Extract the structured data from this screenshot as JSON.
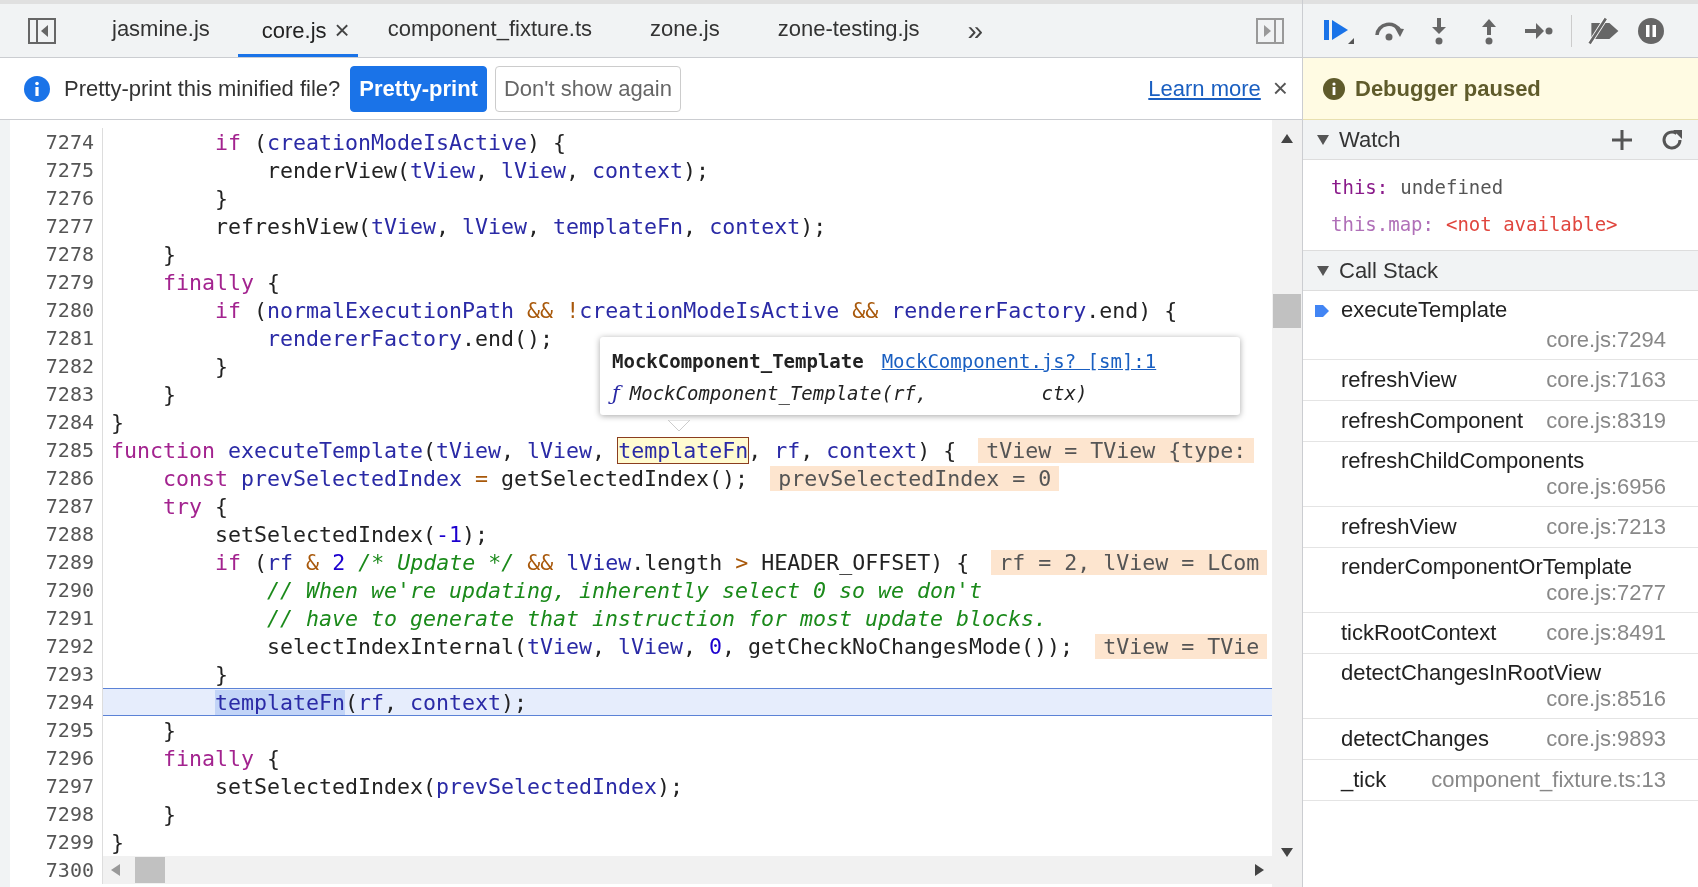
{
  "tabs": [
    {
      "label": "jasmine.js",
      "selected": false
    },
    {
      "label": "core.js",
      "selected": true,
      "close": "×"
    },
    {
      "label": "component_fixture.ts",
      "selected": false
    },
    {
      "label": "zone.js",
      "selected": false
    },
    {
      "label": "zone-testing.js",
      "selected": false
    }
  ],
  "tabs_overflow": "»",
  "infobar": {
    "message": "Pretty-print this minified file?",
    "primary_button": "Pretty-print",
    "secondary_button": "Don't show again",
    "link": "Learn more",
    "close": "×"
  },
  "editor": {
    "lines": [
      {
        "number": "7274",
        "paused": false,
        "tokens": [
          {
            "t": "        if",
            "kind": "keyword"
          },
          {
            "t": " (",
            "kind": "plain"
          },
          {
            "t": "creationModeIsActive",
            "kind": "variable"
          },
          {
            "t": ") {",
            "kind": "plain"
          }
        ]
      },
      {
        "number": "7275",
        "paused": false,
        "tokens": [
          {
            "t": "            renderView(",
            "kind": "plain"
          },
          {
            "t": "tView",
            "kind": "variable"
          },
          {
            "t": ", ",
            "kind": "plain"
          },
          {
            "t": "lView",
            "kind": "variable"
          },
          {
            "t": ", ",
            "kind": "plain"
          },
          {
            "t": "context",
            "kind": "variable"
          },
          {
            "t": ");",
            "kind": "plain"
          }
        ]
      },
      {
        "number": "7276",
        "paused": false,
        "tokens": [
          {
            "t": "        }",
            "kind": "plain"
          }
        ]
      },
      {
        "number": "7277",
        "paused": false,
        "tokens": [
          {
            "t": "        refreshView(",
            "kind": "plain"
          },
          {
            "t": "tView",
            "kind": "variable"
          },
          {
            "t": ", ",
            "kind": "plain"
          },
          {
            "t": "lView",
            "kind": "variable"
          },
          {
            "t": ", ",
            "kind": "plain"
          },
          {
            "t": "templateFn",
            "kind": "variable"
          },
          {
            "t": ", ",
            "kind": "plain"
          },
          {
            "t": "context",
            "kind": "variable"
          },
          {
            "t": ");",
            "kind": "plain"
          }
        ]
      },
      {
        "number": "7278",
        "paused": false,
        "tokens": [
          {
            "t": "    }",
            "kind": "plain"
          }
        ]
      },
      {
        "number": "7279",
        "paused": false,
        "tokens": [
          {
            "t": "    finally",
            "kind": "keyword"
          },
          {
            "t": " {",
            "kind": "plain"
          }
        ]
      },
      {
        "number": "7280",
        "paused": false,
        "tokens": [
          {
            "t": "        if",
            "kind": "keyword"
          },
          {
            "t": " (",
            "kind": "plain"
          },
          {
            "t": "normalExecutionPath",
            "kind": "variable"
          },
          {
            "t": " &&",
            "kind": "operator"
          },
          {
            "t": " !",
            "kind": "operator"
          },
          {
            "t": "creationModeIsActive",
            "kind": "variable"
          },
          {
            "t": " &&",
            "kind": "operator"
          },
          {
            "t": " rendererFactory",
            "kind": "variable"
          },
          {
            "t": ".end) {",
            "kind": "plain"
          }
        ]
      },
      {
        "number": "7281",
        "paused": false,
        "tokens": [
          {
            "t": "            rendererFactory",
            "kind": "variable"
          },
          {
            "t": ".end();",
            "kind": "plain"
          }
        ]
      },
      {
        "number": "7282",
        "paused": false,
        "tokens": [
          {
            "t": "        }",
            "kind": "plain"
          }
        ]
      },
      {
        "number": "7283",
        "paused": false,
        "tokens": [
          {
            "t": "    }",
            "kind": "plain"
          }
        ]
      },
      {
        "number": "7284",
        "paused": false,
        "tokens": [
          {
            "t": "}",
            "kind": "plain"
          }
        ]
      },
      {
        "number": "7285",
        "paused": false,
        "tokens": [
          {
            "t": "function",
            "kind": "keyword"
          },
          {
            "t": " executeTemplate",
            "kind": "variable"
          },
          {
            "t": "(",
            "kind": "plain"
          },
          {
            "t": "tView",
            "kind": "variable"
          },
          {
            "t": ", ",
            "kind": "plain"
          },
          {
            "t": "lView",
            "kind": "variable"
          },
          {
            "t": ", ",
            "kind": "plain"
          },
          {
            "t": "templateFn",
            "kind": "hovered"
          },
          {
            "t": ", ",
            "kind": "plain"
          },
          {
            "t": "rf",
            "kind": "variable"
          },
          {
            "t": ", ",
            "kind": "plain"
          },
          {
            "t": "context",
            "kind": "variable"
          },
          {
            "t": ") {",
            "kind": "plain"
          }
        ],
        "inline_value": "tView = TView {type:"
      },
      {
        "number": "7286",
        "paused": false,
        "tokens": [
          {
            "t": "    const",
            "kind": "keyword"
          },
          {
            "t": " prevSelectedIndex",
            "kind": "variable"
          },
          {
            "t": " =",
            "kind": "operator"
          },
          {
            "t": " getSelectedIndex();",
            "kind": "plain"
          }
        ],
        "inline_value": "prevSelectedIndex = 0"
      },
      {
        "number": "7287",
        "paused": false,
        "tokens": [
          {
            "t": "    try",
            "kind": "keyword"
          },
          {
            "t": " {",
            "kind": "plain"
          }
        ]
      },
      {
        "number": "7288",
        "paused": false,
        "tokens": [
          {
            "t": "        setSelectedIndex(",
            "kind": "plain"
          },
          {
            "t": "-1",
            "kind": "number"
          },
          {
            "t": ");",
            "kind": "plain"
          }
        ]
      },
      {
        "number": "7289",
        "paused": false,
        "tokens": [
          {
            "t": "        if",
            "kind": "keyword"
          },
          {
            "t": " (",
            "kind": "plain"
          },
          {
            "t": "rf",
            "kind": "variable"
          },
          {
            "t": " &",
            "kind": "operator"
          },
          {
            "t": " 2",
            "kind": "number"
          },
          {
            "t": " /* Update */",
            "kind": "comment"
          },
          {
            "t": " &&",
            "kind": "operator"
          },
          {
            "t": " lView",
            "kind": "variable"
          },
          {
            "t": ".length ",
            "kind": "plain"
          },
          {
            "t": ">",
            "kind": "operator"
          },
          {
            "t": " HEADER_OFFSET) {",
            "kind": "plain"
          }
        ],
        "inline_value": "rf = 2, lView = LCom"
      },
      {
        "number": "7290",
        "paused": false,
        "tokens": [
          {
            "t": "            // When we're updating, inherently select 0 so we don't",
            "kind": "comment"
          }
        ]
      },
      {
        "number": "7291",
        "paused": false,
        "tokens": [
          {
            "t": "            // have to generate that instruction for most update blocks.",
            "kind": "comment"
          }
        ]
      },
      {
        "number": "7292",
        "paused": false,
        "tokens": [
          {
            "t": "            selectIndexInternal(",
            "kind": "plain"
          },
          {
            "t": "tView",
            "kind": "variable"
          },
          {
            "t": ", ",
            "kind": "plain"
          },
          {
            "t": "lView",
            "kind": "variable"
          },
          {
            "t": ", ",
            "kind": "plain"
          },
          {
            "t": "0",
            "kind": "number"
          },
          {
            "t": ", getCheckNoChangesMode());",
            "kind": "plain"
          }
        ],
        "inline_value": "tView = TVie"
      },
      {
        "number": "7293",
        "paused": false,
        "tokens": [
          {
            "t": "        }",
            "kind": "plain"
          }
        ]
      },
      {
        "number": "7294",
        "paused": true,
        "tokens": [
          {
            "t": "        templateFn",
            "kind": "execution"
          },
          {
            "t": "(",
            "kind": "plain"
          },
          {
            "t": "rf",
            "kind": "variable"
          },
          {
            "t": ", ",
            "kind": "plain"
          },
          {
            "t": "context",
            "kind": "variable"
          },
          {
            "t": ");",
            "kind": "plain"
          }
        ]
      },
      {
        "number": "7295",
        "paused": false,
        "tokens": [
          {
            "t": "    }",
            "kind": "plain"
          }
        ]
      },
      {
        "number": "7296",
        "paused": false,
        "tokens": [
          {
            "t": "    finally",
            "kind": "keyword"
          },
          {
            "t": " {",
            "kind": "plain"
          }
        ]
      },
      {
        "number": "7297",
        "paused": false,
        "tokens": [
          {
            "t": "        setSelectedIndex(",
            "kind": "plain"
          },
          {
            "t": "prevSelectedIndex",
            "kind": "variable"
          },
          {
            "t": ");",
            "kind": "plain"
          }
        ]
      },
      {
        "number": "7298",
        "paused": false,
        "tokens": [
          {
            "t": "    }",
            "kind": "plain"
          }
        ]
      },
      {
        "number": "7299",
        "paused": false,
        "tokens": [
          {
            "t": "}",
            "kind": "plain"
          }
        ]
      }
    ],
    "last_line_number": "7300",
    "tooltip": {
      "title": "MockComponent_Template",
      "link": "MockComponent.js? [sm]:1",
      "func_mark": "ƒ",
      "signature": "MockComponent_Template(rf,          ctx)"
    }
  },
  "debugger": {
    "status": "Debugger paused",
    "watch": {
      "title": "Watch",
      "expanded": true,
      "items": [
        {
          "name": "this:",
          "value": "undefined",
          "kind": "value"
        },
        {
          "name": "this.map:",
          "value": "<not available>",
          "kind": "unavailable"
        }
      ]
    },
    "call_stack": {
      "title": "Call Stack",
      "expanded": true,
      "frames": [
        {
          "name": "executeTemplate",
          "location": "core.js:7294",
          "selected": true
        },
        {
          "name": "refreshView",
          "location": "core.js:7163",
          "selected": false
        },
        {
          "name": "refreshComponent",
          "location": "core.js:8319",
          "selected": false
        },
        {
          "name": "refreshChildComponents",
          "location": "core.js:6956",
          "selected": false
        },
        {
          "name": "refreshView",
          "location": "core.js:7213",
          "selected": false
        },
        {
          "name": "renderComponentOrTemplate",
          "location": "core.js:7277",
          "selected": false
        },
        {
          "name": "tickRootContext",
          "location": "core.js:8491",
          "selected": false
        },
        {
          "name": "detectChangesInRootView",
          "location": "core.js:8516",
          "selected": false
        },
        {
          "name": "detectChanges",
          "location": "core.js:9893",
          "selected": false
        },
        {
          "name": "_tick",
          "location": "component_fixture.ts:13",
          "selected": false
        }
      ]
    }
  }
}
